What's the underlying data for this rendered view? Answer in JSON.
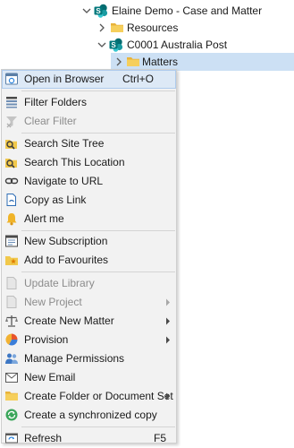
{
  "tree": {
    "items": [
      {
        "label": "Elaine Demo - Case and Matter",
        "expanded": true,
        "icon": "sharepoint-site-icon"
      },
      {
        "label": "Resources",
        "expanded": false,
        "icon": "folder-icon"
      },
      {
        "label": "C0001 Australia Post",
        "expanded": true,
        "icon": "sharepoint-site-icon"
      },
      {
        "label": "Matters",
        "expanded": false,
        "selected": true,
        "icon": "folder-icon"
      }
    ]
  },
  "menu": {
    "items": [
      {
        "label": "Open in Browser",
        "shortcut": "Ctrl+O",
        "icon": "browser-icon"
      },
      {
        "label": "Filter Folders",
        "icon": "filter-icon"
      },
      {
        "label": "Clear Filter",
        "icon": "clear-filter-icon",
        "disabled": true
      },
      {
        "label": "Search Site Tree",
        "icon": "search-site-icon"
      },
      {
        "label": "Search This Location",
        "icon": "search-location-icon"
      },
      {
        "label": "Navigate to URL",
        "icon": "link-icon"
      },
      {
        "label": "Copy as Link",
        "icon": "copy-link-icon"
      },
      {
        "label": "Alert me",
        "icon": "bell-icon"
      },
      {
        "label": "New Subscription",
        "icon": "subscription-icon"
      },
      {
        "label": "Add to Favourites",
        "icon": "favourite-folder-icon"
      },
      {
        "label": "Update Library",
        "icon": "library-icon",
        "disabled": true
      },
      {
        "label": "New Project",
        "icon": "project-icon",
        "disabled": true,
        "submenu": true
      },
      {
        "label": "Create New Matter",
        "icon": "scales-icon",
        "submenu": true
      },
      {
        "label": "Provision",
        "icon": "pie-icon",
        "submenu": true
      },
      {
        "label": "Manage Permissions",
        "icon": "people-icon"
      },
      {
        "label": "New Email",
        "icon": "email-icon"
      },
      {
        "label": "Create Folder or Document Set",
        "icon": "folder-icon",
        "submenu": true
      },
      {
        "label": "Create a synchronized copy",
        "icon": "sync-icon"
      },
      {
        "label": "Refresh",
        "shortcut": "F5",
        "icon": "refresh-icon"
      }
    ]
  },
  "colors": {
    "accent": "#0078d4",
    "sharepoint_teal": "#038387",
    "folder": "#f1c84b",
    "selection": "#cce0f4",
    "menu_background": "#f2f2f2",
    "disabled_text": "#8c8c8c"
  }
}
